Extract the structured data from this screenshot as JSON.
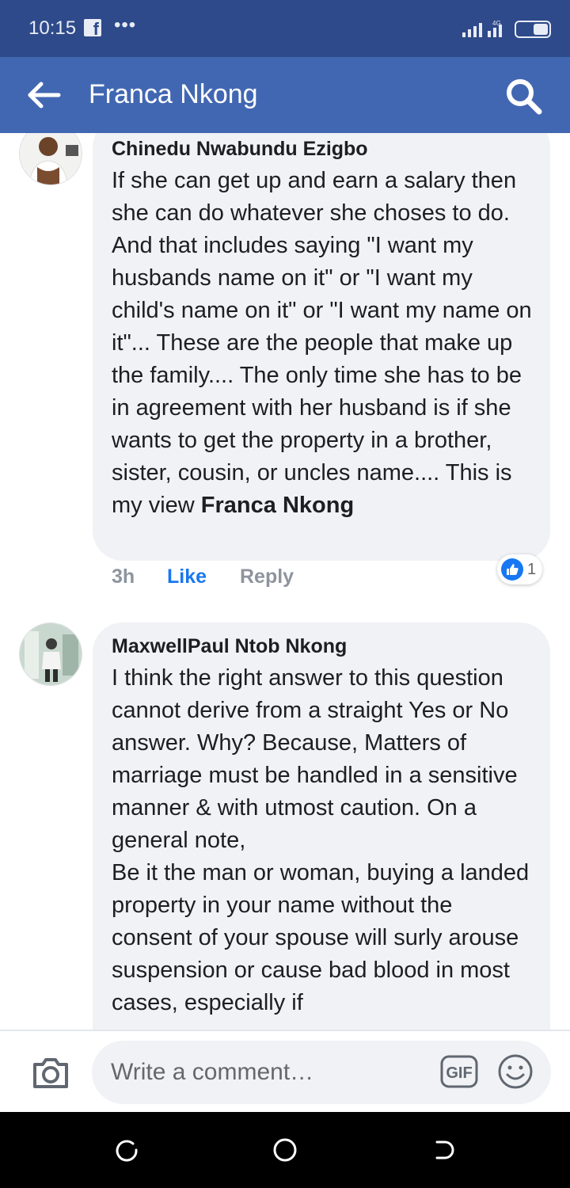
{
  "status_bar": {
    "time": "10:15",
    "notification_icon": "facebook-icon",
    "overflow_dots": "•••",
    "network_label": "4G"
  },
  "header": {
    "title": "Franca Nkong",
    "back_icon": "arrow-left-icon",
    "search_icon": "search-icon"
  },
  "colors": {
    "header_bg": "#4267b2",
    "status_bg": "#2e4a8a",
    "bubble_bg": "#f0f2f5",
    "like_blue": "#1877f2",
    "meta_gray": "#8d949e"
  },
  "comments": [
    {
      "author": "Chinedu Nwabundu Ezigbo",
      "text": "If she can get up and earn a salary then she can do whatever she choses to do. And that includes saying \"I want my husbands name on it\" or \"I want my child's name on it\" or \"I want my name on it\"... These are the people that make up the family.... The only time she has to be in agreement with her husband is if she wants to get the property in a brother, sister, cousin, or uncles name.... This is my view ",
      "mention": "Franca Nkong",
      "time": "3h",
      "like_label": "Like",
      "reply_label": "Reply",
      "reaction_count": "1"
    },
    {
      "author": "MaxwellPaul Ntob Nkong",
      "text": "I think the right answer to this question cannot derive from a straight Yes or No answer. Why? Because, Matters of marriage must be handled in a sensitive manner & with utmost caution. On a general note,\nBe it the man or woman, buying a landed property in your name without the consent of your spouse will surly arouse suspension or cause bad blood in most cases, especially if"
    }
  ],
  "composer": {
    "placeholder": "Write a comment…",
    "gif_label": "GIF"
  }
}
